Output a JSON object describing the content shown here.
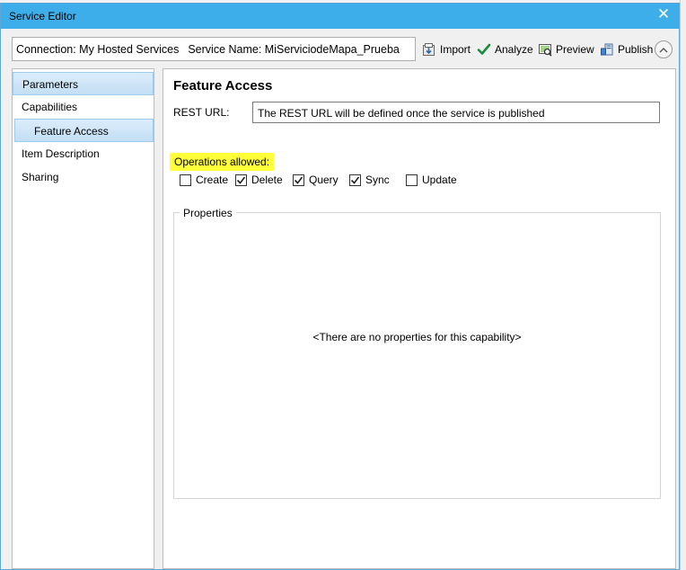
{
  "window": {
    "title": "Service Editor",
    "close_glyph": "✕"
  },
  "connection_bar": {
    "connection": "Connection: My Hosted Services",
    "service_name": "Service Name: MiServiciodeMapa_Prueba"
  },
  "toolbar": {
    "import_label": "Import",
    "analyze_label": "Analyze",
    "preview_label": "Preview",
    "publish_label": "Publish",
    "icons": [
      "import-icon",
      "analyze-check-icon",
      "preview-icon",
      "publish-icon",
      "collapse-chevron-up-icon"
    ]
  },
  "sidebar": {
    "items": [
      {
        "label": "Parameters",
        "selected": true
      },
      {
        "label": "Capabilities",
        "selected": false
      },
      {
        "label": "Feature Access",
        "selected": true,
        "indent": true
      },
      {
        "label": "Item Description",
        "selected": false
      },
      {
        "label": "Sharing",
        "selected": false
      }
    ]
  },
  "main": {
    "heading": "Feature Access",
    "rest_url_label": "REST URL:",
    "rest_url_value": "The REST URL will be defined once the service is published",
    "operations_label": "Operations allowed:",
    "operations": [
      {
        "label": "Create",
        "checked": false
      },
      {
        "label": "Delete",
        "checked": true
      },
      {
        "label": "Query",
        "checked": true
      },
      {
        "label": "Sync",
        "checked": true
      },
      {
        "label": "Update",
        "checked": false
      }
    ],
    "properties_legend": "Properties",
    "properties_empty": "<There are no properties for this capability>"
  },
  "colors": {
    "titlebar": "#3daee9",
    "highlight": "#ffff3a",
    "selection": "#c3def4",
    "analyze_green": "#1b8a3c"
  }
}
